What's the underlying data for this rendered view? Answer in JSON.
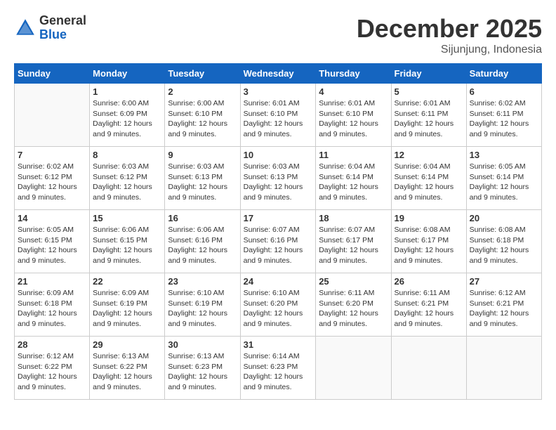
{
  "logo": {
    "general": "General",
    "blue": "Blue"
  },
  "title": "December 2025",
  "subtitle": "Sijunjung, Indonesia",
  "days_of_week": [
    "Sunday",
    "Monday",
    "Tuesday",
    "Wednesday",
    "Thursday",
    "Friday",
    "Saturday"
  ],
  "weeks": [
    [
      {
        "num": "",
        "info": ""
      },
      {
        "num": "1",
        "info": "Sunrise: 6:00 AM\nSunset: 6:09 PM\nDaylight: 12 hours\nand 9 minutes."
      },
      {
        "num": "2",
        "info": "Sunrise: 6:00 AM\nSunset: 6:10 PM\nDaylight: 12 hours\nand 9 minutes."
      },
      {
        "num": "3",
        "info": "Sunrise: 6:01 AM\nSunset: 6:10 PM\nDaylight: 12 hours\nand 9 minutes."
      },
      {
        "num": "4",
        "info": "Sunrise: 6:01 AM\nSunset: 6:10 PM\nDaylight: 12 hours\nand 9 minutes."
      },
      {
        "num": "5",
        "info": "Sunrise: 6:01 AM\nSunset: 6:11 PM\nDaylight: 12 hours\nand 9 minutes."
      },
      {
        "num": "6",
        "info": "Sunrise: 6:02 AM\nSunset: 6:11 PM\nDaylight: 12 hours\nand 9 minutes."
      }
    ],
    [
      {
        "num": "7",
        "info": "Sunrise: 6:02 AM\nSunset: 6:12 PM\nDaylight: 12 hours\nand 9 minutes."
      },
      {
        "num": "8",
        "info": "Sunrise: 6:03 AM\nSunset: 6:12 PM\nDaylight: 12 hours\nand 9 minutes."
      },
      {
        "num": "9",
        "info": "Sunrise: 6:03 AM\nSunset: 6:13 PM\nDaylight: 12 hours\nand 9 minutes."
      },
      {
        "num": "10",
        "info": "Sunrise: 6:03 AM\nSunset: 6:13 PM\nDaylight: 12 hours\nand 9 minutes."
      },
      {
        "num": "11",
        "info": "Sunrise: 6:04 AM\nSunset: 6:14 PM\nDaylight: 12 hours\nand 9 minutes."
      },
      {
        "num": "12",
        "info": "Sunrise: 6:04 AM\nSunset: 6:14 PM\nDaylight: 12 hours\nand 9 minutes."
      },
      {
        "num": "13",
        "info": "Sunrise: 6:05 AM\nSunset: 6:14 PM\nDaylight: 12 hours\nand 9 minutes."
      }
    ],
    [
      {
        "num": "14",
        "info": "Sunrise: 6:05 AM\nSunset: 6:15 PM\nDaylight: 12 hours\nand 9 minutes."
      },
      {
        "num": "15",
        "info": "Sunrise: 6:06 AM\nSunset: 6:15 PM\nDaylight: 12 hours\nand 9 minutes."
      },
      {
        "num": "16",
        "info": "Sunrise: 6:06 AM\nSunset: 6:16 PM\nDaylight: 12 hours\nand 9 minutes."
      },
      {
        "num": "17",
        "info": "Sunrise: 6:07 AM\nSunset: 6:16 PM\nDaylight: 12 hours\nand 9 minutes."
      },
      {
        "num": "18",
        "info": "Sunrise: 6:07 AM\nSunset: 6:17 PM\nDaylight: 12 hours\nand 9 minutes."
      },
      {
        "num": "19",
        "info": "Sunrise: 6:08 AM\nSunset: 6:17 PM\nDaylight: 12 hours\nand 9 minutes."
      },
      {
        "num": "20",
        "info": "Sunrise: 6:08 AM\nSunset: 6:18 PM\nDaylight: 12 hours\nand 9 minutes."
      }
    ],
    [
      {
        "num": "21",
        "info": "Sunrise: 6:09 AM\nSunset: 6:18 PM\nDaylight: 12 hours\nand 9 minutes."
      },
      {
        "num": "22",
        "info": "Sunrise: 6:09 AM\nSunset: 6:19 PM\nDaylight: 12 hours\nand 9 minutes."
      },
      {
        "num": "23",
        "info": "Sunrise: 6:10 AM\nSunset: 6:19 PM\nDaylight: 12 hours\nand 9 minutes."
      },
      {
        "num": "24",
        "info": "Sunrise: 6:10 AM\nSunset: 6:20 PM\nDaylight: 12 hours\nand 9 minutes."
      },
      {
        "num": "25",
        "info": "Sunrise: 6:11 AM\nSunset: 6:20 PM\nDaylight: 12 hours\nand 9 minutes."
      },
      {
        "num": "26",
        "info": "Sunrise: 6:11 AM\nSunset: 6:21 PM\nDaylight: 12 hours\nand 9 minutes."
      },
      {
        "num": "27",
        "info": "Sunrise: 6:12 AM\nSunset: 6:21 PM\nDaylight: 12 hours\nand 9 minutes."
      }
    ],
    [
      {
        "num": "28",
        "info": "Sunrise: 6:12 AM\nSunset: 6:22 PM\nDaylight: 12 hours\nand 9 minutes."
      },
      {
        "num": "29",
        "info": "Sunrise: 6:13 AM\nSunset: 6:22 PM\nDaylight: 12 hours\nand 9 minutes."
      },
      {
        "num": "30",
        "info": "Sunrise: 6:13 AM\nSunset: 6:23 PM\nDaylight: 12 hours\nand 9 minutes."
      },
      {
        "num": "31",
        "info": "Sunrise: 6:14 AM\nSunset: 6:23 PM\nDaylight: 12 hours\nand 9 minutes."
      },
      {
        "num": "",
        "info": ""
      },
      {
        "num": "",
        "info": ""
      },
      {
        "num": "",
        "info": ""
      }
    ]
  ]
}
